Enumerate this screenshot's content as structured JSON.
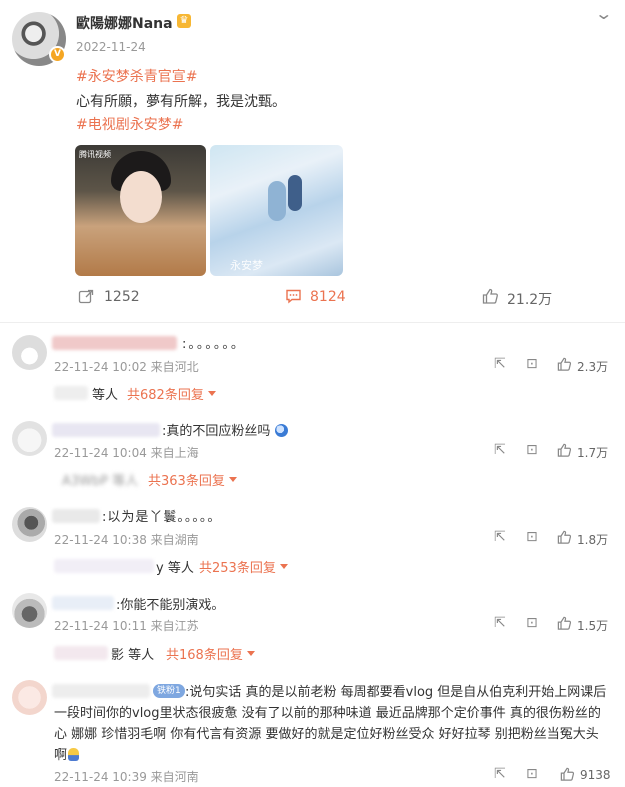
{
  "post": {
    "username": "歐陽娜娜Nana",
    "crown_icon": "crown-icon",
    "date": "2022-11-24",
    "hashtag1": "#永安梦杀青官宣#",
    "text": "心有所願，夢有所解，我是沈甄。",
    "hashtag2": "#电视剧永安梦#",
    "image1_watermark": "腾讯视频",
    "image2_caption": "永安梦",
    "reposts": "1252",
    "comments": "8124",
    "likes": "21.2万"
  },
  "comments": [
    {
      "text": ":。。。。。。",
      "meta": "22-11-24 10:02 来自河北",
      "likes": "2.3万",
      "reply_names": "等人",
      "reply_count": "共682条回复"
    },
    {
      "text": ":真的不回应粉丝吗",
      "meta": "22-11-24 10:04 来自上海",
      "likes": "1.7万",
      "reply_names": "A3WbP 等人",
      "reply_count": "共363条回复"
    },
    {
      "text": ":以为是丫鬟。。。。。",
      "meta": "22-11-24 10:38 来自湖南",
      "likes": "1.8万",
      "reply_names": "y 等人",
      "reply_count": "共253条回复"
    },
    {
      "text": ":你能不能别演戏。",
      "meta": "22-11-24 10:11 来自江苏",
      "likes": "1.5万",
      "reply_names": "影 等人",
      "reply_count": "共168条回复"
    },
    {
      "text_line1": ":说句实话 真的是以前老粉 每周都要看vlog 但是自从伯克利开始上网课后",
      "text_line2": "一段时间你的vlog里状态很疲惫 没有了以前的那种味道 最近品牌那个定价事件 真的很伤粉丝的",
      "text_line3": "心 娜娜 珍惜羽毛啊 你有代言有资源 要做好的就是定位好粉丝受众 好好拉琴 别把粉丝当冤大头",
      "text_line4": "啊",
      "meta": "22-11-24 10:39 来自河南",
      "likes": "9138",
      "badge": "铁粉1"
    }
  ],
  "colors": {
    "accent": "#eb7350",
    "meta": "#999999",
    "text": "#333333"
  }
}
